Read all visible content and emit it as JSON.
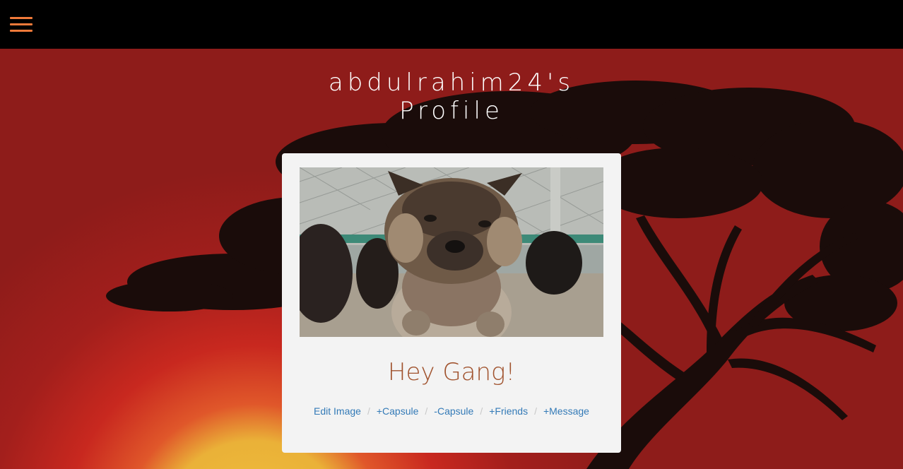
{
  "profile": {
    "title_line1": "abdulrahim24's",
    "title_line2": "Profile",
    "status": "Hey Gang!"
  },
  "actions": {
    "edit_image": "Edit Image",
    "add_capsule": "+Capsule",
    "remove_capsule": "-Capsule",
    "add_friends": "+Friends",
    "message": "+Message",
    "separator": "/"
  },
  "colors": {
    "menu_accent": "#f07a3a",
    "status_text": "#a0522d",
    "link": "#337ab7"
  }
}
